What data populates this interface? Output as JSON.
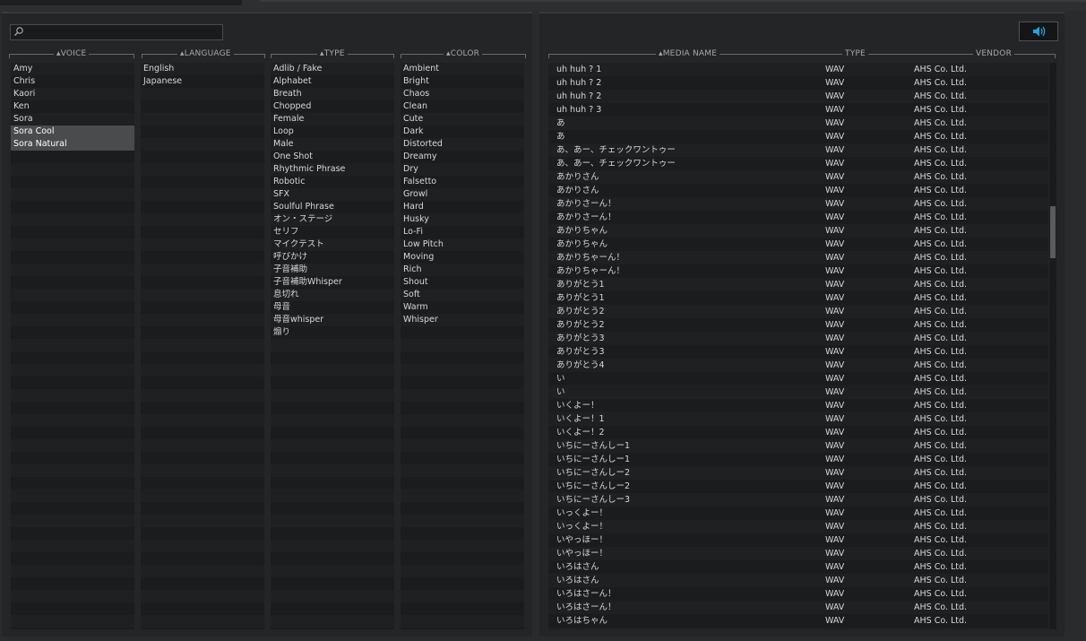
{
  "search": {
    "placeholder": ""
  },
  "columns": {
    "voice": "VOICE",
    "language": "LANGUAGE",
    "type": "TYPE",
    "color": "COLOR"
  },
  "voices": [
    "Amy",
    "Chris",
    "Kaori",
    "Ken",
    "Sora",
    "Sora Cool",
    "Sora Natural"
  ],
  "voices_selected": [
    5,
    6
  ],
  "languages": [
    "English",
    "Japanese"
  ],
  "types": [
    "Adlib / Fake",
    "Alphabet",
    "Breath",
    "Chopped",
    "Female",
    "Loop",
    "Male",
    "One Shot",
    "Rhythmic Phrase",
    "Robotic",
    "SFX",
    "Soulful Phrase",
    "オン・ステージ",
    "セリフ",
    "マイクテスト",
    "呼びかけ",
    "子音補助",
    "子音補助Whisper",
    "息切れ",
    "母音",
    "母音whisper",
    "煽り"
  ],
  "colors": [
    "Ambient",
    "Bright",
    "Chaos",
    "Clean",
    "Cute",
    "Dark",
    "Distorted",
    "Dreamy",
    "Dry",
    "Falsetto",
    "Growl",
    "Hard",
    "Husky",
    "Lo-Fi",
    "Low Pitch",
    "Moving",
    "Rich",
    "Shout",
    "Soft",
    "Warm",
    "Whisper"
  ],
  "media_columns": {
    "name": "MEDIA NAME",
    "type": "TYPE",
    "vendor": "VENDOR"
  },
  "media_type": "WAV",
  "media_vendor": "AHS Co. Ltd.",
  "media": [
    "uh huh ? 1",
    "uh huh ? 2",
    "uh huh ? 2",
    "uh huh ? 3",
    "あ",
    "あ",
    "あ、あー、チェックワントゥー",
    "あ、あー、チェックワントゥー",
    "あかりさん",
    "あかりさん",
    "あかりさーん！",
    "あかりさーん！",
    "あかりちゃん",
    "あかりちゃん",
    "あかりちゃーん！",
    "あかりちゃーん！",
    "ありがとう1",
    "ありがとう1",
    "ありがとう2",
    "ありがとう2",
    "ありがとう3",
    "ありがとう3",
    "ありがとう4",
    "い",
    "い",
    "いくよー！",
    "いくよー！1",
    "いくよー！2",
    "いちにーさんしー1",
    "いちにーさんしー1",
    "いちにーさんしー2",
    "いちにーさんしー2",
    "いちにーさんしー3",
    "いっくよー！",
    "いっくよー！",
    "いやっほー！",
    "いやっほー！",
    "いろはさん",
    "いろはさん",
    "いろはさーん！",
    "いろはさーん！",
    "いろはちゃん"
  ],
  "colors_ui": {
    "accent": "#2aa0e0",
    "selected": "#4a4b4d"
  }
}
